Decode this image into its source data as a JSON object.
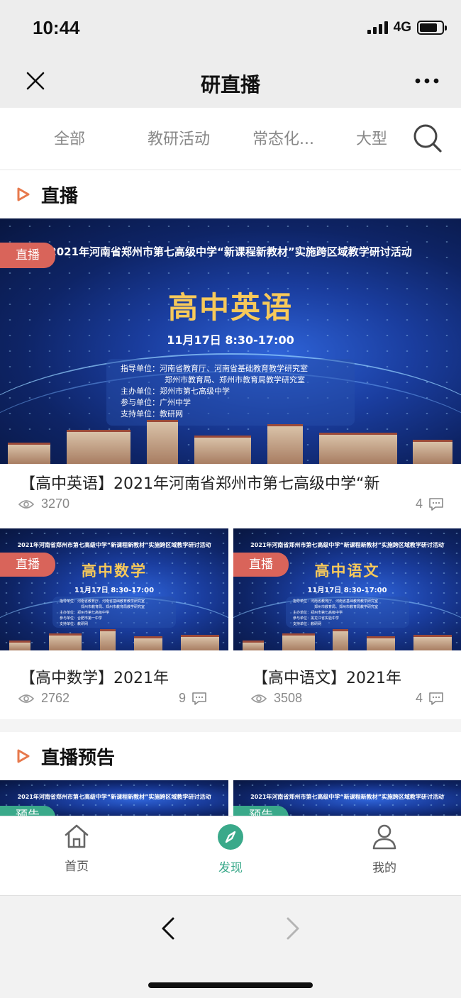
{
  "status": {
    "time": "10:44",
    "network": "4G",
    "battery_level": 0.8
  },
  "nav": {
    "title": "研直播",
    "close_icon": "close-icon",
    "more_icon": "more-icon"
  },
  "tabs": [
    {
      "label": "全部",
      "selected": false
    },
    {
      "label": "教研活动",
      "selected": false
    },
    {
      "label": "常态化...",
      "selected": false
    },
    {
      "label": "大型",
      "selected": false
    }
  ],
  "sections": {
    "live": {
      "title": "直播"
    },
    "preview": {
      "title": "直播预告"
    }
  },
  "banner_text": {
    "headline": "2021年河南省郑州市第七高级中学“新课程新教材”实施跨区域教学研讨活动",
    "date": "11月17日 8:30-17:00",
    "info_lines": [
      "指导单位：河南省教育厅、河南省基础教育教学研究室",
      "郑州市教育局、郑州市教育局教学研究室",
      "主办单位：郑州市第七高级中学",
      "参与单位：广州中学",
      "支持单位：教研网"
    ]
  },
  "featured": {
    "badge": "直播",
    "subject": "高中英语",
    "title": "【高中英语】2021年河南省郑州市第七高级中学“新",
    "views": "3270",
    "comments": "4"
  },
  "grid": [
    {
      "badge": "直播",
      "subject": "高中数学",
      "title": "【高中数学】2021年",
      "views": "2762",
      "comments": "9",
      "info_lines": [
        "指导单位：河南省教育厅、河南省基础教育教学研究室",
        "郑州市教育局、郑州市教育局教学研究室",
        "主办单位：郑州市第七高级中学",
        "参与单位：合肥市第一中学",
        "支持单位：教研网"
      ]
    },
    {
      "badge": "直播",
      "subject": "高中语文",
      "title": "【高中语文】2021年",
      "views": "3508",
      "comments": "4",
      "info_lines": [
        "指导单位：河南省教育厅、河南省基础教育教学研究室",
        "郑州市教育局、郑州市教育局教学研究室",
        "主办单位：郑州市第七高级中学",
        "参与单位：黑龙江省实验中学",
        "支持单位：教研网"
      ]
    }
  ],
  "previews": [
    {
      "badge": "预告",
      "headline": "2021年河南省郑州市第七高级中学“新课程新教材”实施跨区域教学研讨活动"
    },
    {
      "badge": "预告",
      "headline": "2021年河南省郑州市第七高级中学“新课程新教材”实施跨区域教学研讨活动"
    }
  ],
  "tabbar": [
    {
      "label": "首页",
      "icon": "home-icon",
      "active": false
    },
    {
      "label": "发现",
      "icon": "compass-icon",
      "active": true
    },
    {
      "label": "我的",
      "icon": "profile-icon",
      "active": false
    }
  ],
  "colors": {
    "accent_green": "#3aa98a",
    "live_badge": "#d9645a",
    "section_triangle": "#e7794c"
  }
}
